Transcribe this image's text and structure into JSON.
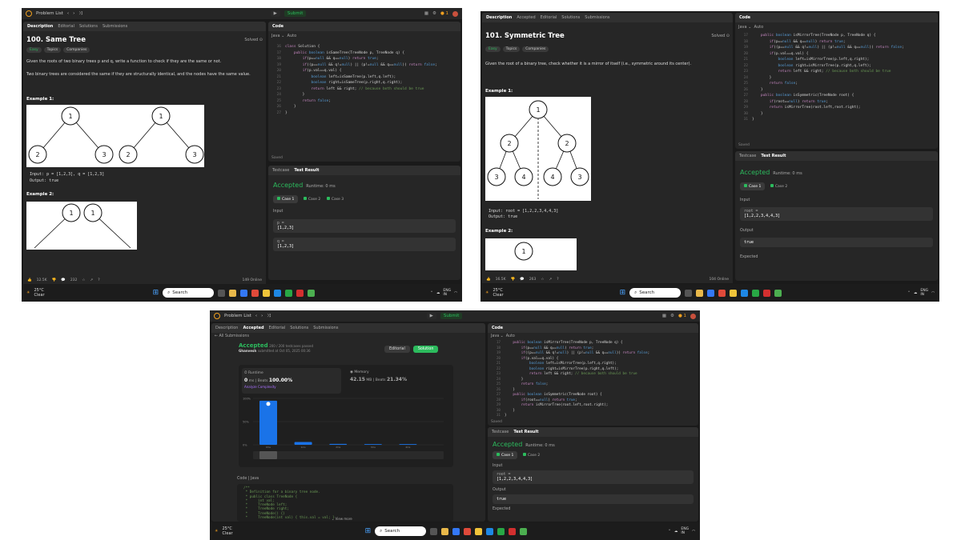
{
  "s1": {
    "topbar": {
      "title": "Problem List",
      "submit": "Submit"
    },
    "tabs": [
      "Description",
      "Editorial",
      "Solutions",
      "Submissions"
    ],
    "title": "100. Same Tree",
    "solved": "Solved ⊙",
    "chips": [
      "Easy",
      "Topics",
      "Companies"
    ],
    "desc1": "Given the roots of two binary trees p and q, write a function to check if they are the same or not.",
    "desc2": "Two binary trees are considered the same if they are structurally identical, and the nodes have the same value.",
    "ex1": "Example 1:",
    "input": "Input: p = [1,2,3], q = [1,2,3]",
    "output": "Output: true",
    "ex2": "Example 2:",
    "tree": [
      "1",
      "2",
      "3",
      "1",
      "2",
      "3"
    ],
    "tree2": [
      "1",
      "1"
    ],
    "code_tab": "Code",
    "lang": "Java",
    "auto": "Auto",
    "code": [
      {
        "n": "16",
        "t": "class Solution {"
      },
      {
        "n": "17",
        "t": "    public boolean isSameTree(TreeNode p, TreeNode q) {"
      },
      {
        "n": "18",
        "t": "        if(p==null && q==null) return true;"
      },
      {
        "n": "19",
        "t": "        if((p==null && q!=null) || (p!=null && q==null)) return false;"
      },
      {
        "n": "20",
        "t": "        if(p.val==q.val) {"
      },
      {
        "n": "21",
        "t": "            boolean left=isSameTree(p.left,q.left);"
      },
      {
        "n": "22",
        "t": "            boolean right=isSameTree(p.right,q.right);"
      },
      {
        "n": "23",
        "t": "            return left && right; // because both should be true"
      },
      {
        "n": "24",
        "t": "        }"
      },
      {
        "n": "25",
        "t": "        return false;"
      },
      {
        "n": "26",
        "t": "    }"
      },
      {
        "n": "27",
        "t": "}"
      }
    ],
    "saved": "Saved",
    "rtabs": [
      "Testcase",
      "Test Result"
    ],
    "accepted": "Accepted",
    "runtime": "Runtime: 0 ms",
    "cases": [
      "Case 1",
      "Case 2",
      "Case 3"
    ],
    "input_label": "Input",
    "p_label": "p =",
    "p_val": "[1,2,3]",
    "q_label": "q =",
    "q_val": "[1,2,3]",
    "footer": {
      "likes": "12.5K",
      "comments": "232",
      "online": "149 Online"
    },
    "taskbar": {
      "temp": "25°C",
      "weather": "Clear",
      "search": "Search",
      "lang": "ENG",
      "region": "IN"
    }
  },
  "s2": {
    "tabs": [
      "Description",
      "Accepted",
      "Editorial",
      "Solutions",
      "Submissions"
    ],
    "title": "101. Symmetric Tree",
    "solved": "Solved ⊙",
    "chips": [
      "Easy",
      "Topics",
      "Companies"
    ],
    "desc": "Given the root of a binary tree, check whether it is a mirror of itself (i.e., symmetric around its center).",
    "ex1": "Example 1:",
    "input": "Input: root = [1,2,2,3,4,4,3]",
    "output": "Output: true",
    "ex2": "Example 2:",
    "tree": [
      "1",
      "2",
      "2",
      "3",
      "4",
      "4",
      "3"
    ],
    "tree2": [
      "1"
    ],
    "code_tab": "Code",
    "lang": "Java",
    "auto": "Auto",
    "code": [
      {
        "n": "17",
        "t": "    public boolean isMirrorTree(TreeNode p, TreeNode q) {"
      },
      {
        "n": "18",
        "t": "        if(p==null && q==null) return true;"
      },
      {
        "n": "19",
        "t": "        if((p==null && q!=null) || (p!=null && q==null)) return false;"
      },
      {
        "n": "20",
        "t": "        if(p.val==q.val) {"
      },
      {
        "n": "21",
        "t": "            boolean left=isMirrorTree(p.left,q.right);"
      },
      {
        "n": "22",
        "t": "            boolean right=isMirrorTree(p.right,q.left);"
      },
      {
        "n": "23",
        "t": "            return left && right; // because both should be true"
      },
      {
        "n": "24",
        "t": "        }"
      },
      {
        "n": "25",
        "t": "        return false;"
      },
      {
        "n": "26",
        "t": "    }"
      },
      {
        "n": "27",
        "t": "    public boolean isSymmetric(TreeNode root) {"
      },
      {
        "n": "28",
        "t": "        if(root==null) return true;"
      },
      {
        "n": "29",
        "t": "        return isMirrorTree(root.left,root.right);"
      },
      {
        "n": "30",
        "t": "    }"
      },
      {
        "n": "31",
        "t": "}"
      }
    ],
    "saved": "Saved",
    "rtabs": [
      "Testcase",
      "Test Result"
    ],
    "accepted": "Accepted",
    "runtime": "Runtime: 0 ms",
    "cases": [
      "Case 1",
      "Case 2"
    ],
    "input_label": "Input",
    "root_label": "root =",
    "root_val": "[1,2,2,3,4,4,3]",
    "output_label": "Output",
    "output_val": "true",
    "expected_label": "Expected",
    "footer": {
      "likes": "16.5K",
      "comments": "263",
      "online": "104 Online"
    },
    "taskbar": {
      "temp": "25°C",
      "weather": "Clear",
      "search": "Search",
      "lang": "ENG",
      "region": "IN"
    }
  },
  "s3": {
    "topbar": {
      "title": "Problem List",
      "submit": "Submit"
    },
    "tabs": [
      "Description",
      "Accepted",
      "Editorial",
      "Solutions",
      "Submissions"
    ],
    "all_submissions": "All Submissions",
    "status": "Accepted",
    "passed": "200 / 200 testcases passed",
    "user": "Ghanvesh",
    "submitted": "submitted at Oct 05, 2025 00:36",
    "editorial_btn": "Editorial",
    "solution_btn": "Solution",
    "runtime_label": "Runtime",
    "runtime_val": "0",
    "runtime_unit": "ms",
    "beats_label": "Beats",
    "beats_val": "100.00%",
    "complexity": "Analyze Complexity",
    "memory_label": "Memory",
    "memory_val": "42.15",
    "memory_unit": "MB",
    "mem_beats_label": "Beats",
    "mem_beats_val": "21.34%",
    "chart_data": {
      "type": "bar",
      "categories": [
        "0ms",
        "1ms",
        "2ms",
        "3ms",
        "4ms"
      ],
      "values": [
        95,
        6,
        2,
        1.5,
        1.5
      ],
      "ylim": [
        0,
        100
      ],
      "yticks": [
        "100%",
        "50%",
        "0%"
      ],
      "xlabel": "",
      "ylabel": "",
      "grid": true,
      "highlight": "0ms"
    },
    "code_label": "Code",
    "code_lang": "Java",
    "code_preview": [
      "/**",
      " * Definition for a binary tree node.",
      " * public class TreeNode {",
      " *     int val;",
      " *     TreeNode left;",
      " *     TreeNode right;",
      " *     TreeNode() {}",
      " *     TreeNode(int val) { this.val = val; }"
    ],
    "view_more": "View more",
    "code_tab": "Code",
    "lang": "Java",
    "auto": "Auto",
    "code": [
      {
        "n": "17",
        "t": "    public boolean isMirrorTree(TreeNode p, TreeNode q) {"
      },
      {
        "n": "18",
        "t": "        if(p==null && q==null) return true;"
      },
      {
        "n": "19",
        "t": "        if((p==null && q!=null) || (p!=null && q==null)) return false;"
      },
      {
        "n": "20",
        "t": "        if(p.val==q.val) {"
      },
      {
        "n": "21",
        "t": "            boolean left=isMirrorTree(p.left,q.right);"
      },
      {
        "n": "22",
        "t": "            boolean right=isMirrorTree(p.right,q.left);"
      },
      {
        "n": "23",
        "t": "            return left && right; // because both should be true"
      },
      {
        "n": "24",
        "t": "        }"
      },
      {
        "n": "25",
        "t": "        return false;"
      },
      {
        "n": "26",
        "t": "    }"
      },
      {
        "n": "27",
        "t": "    public boolean isSymmetric(TreeNode root) {"
      },
      {
        "n": "28",
        "t": "        if(root==null) return true;"
      },
      {
        "n": "29",
        "t": "        return isMirrorTree(root.left,root.right);"
      },
      {
        "n": "30",
        "t": "    }"
      },
      {
        "n": "31",
        "t": "}"
      }
    ],
    "saved": "Saved",
    "rtabs": [
      "Testcase",
      "Test Result"
    ],
    "accepted": "Accepted",
    "runtime": "Runtime: 0 ms",
    "cases": [
      "Case 1",
      "Case 2"
    ],
    "input_label": "Input",
    "root_label": "root =",
    "root_val": "[1,2,2,3,4,4,3]",
    "output_label": "Output",
    "output_val": "true",
    "expected_label": "Expected",
    "taskbar": {
      "temp": "25°C",
      "weather": "Clear",
      "search": "Search",
      "lang": "ENG",
      "region": "IN"
    }
  },
  "colors": {
    "accent": "#2cbb5d",
    "bg": "#1a1a1a",
    "panel": "#262626",
    "bar": "#1a73e8",
    "streak": "#f0a020"
  }
}
